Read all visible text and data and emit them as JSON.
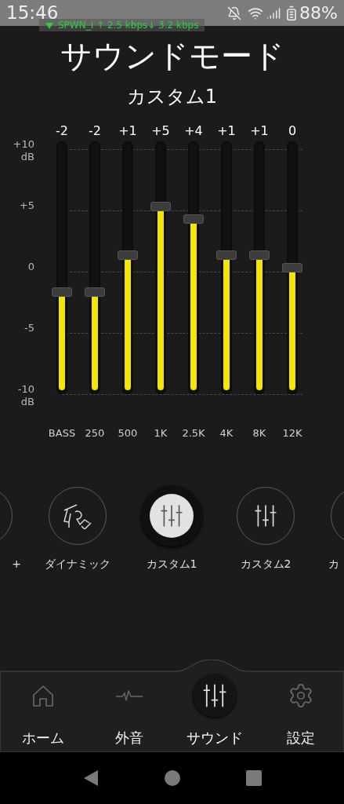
{
  "status_bar": {
    "time": "15:46",
    "battery": "88%",
    "network_overlay": "SPWN_I ↑  2.5 kbps↓  3.2 kbps"
  },
  "title": "サウンドモード",
  "preset_name": "カスタム1",
  "scale_labels": [
    {
      "value": "+10",
      "unit": "dB"
    },
    {
      "value": "+5"
    },
    {
      "value": "0"
    },
    {
      "value": "-5"
    },
    {
      "value": "-10",
      "unit": "dB"
    }
  ],
  "bands": [
    {
      "gain": "-2",
      "freq": "BASS",
      "level": 0.4
    },
    {
      "gain": "-2",
      "freq": "250",
      "level": 0.4
    },
    {
      "gain": "+1",
      "freq": "500",
      "level": 0.55
    },
    {
      "gain": "+5",
      "freq": "1K",
      "level": 0.75
    },
    {
      "gain": "+4",
      "freq": "2.5K",
      "level": 0.7
    },
    {
      "gain": "+1",
      "freq": "4K",
      "level": 0.55
    },
    {
      "gain": "+1",
      "freq": "8K",
      "level": 0.55
    },
    {
      "gain": "0",
      "freq": "12K",
      "level": 0.5
    }
  ],
  "presets": [
    {
      "label": "+",
      "kind": "blank",
      "selected": false
    },
    {
      "label": "ダイナミック",
      "kind": "dynamic",
      "selected": false
    },
    {
      "label": "カスタム1",
      "kind": "custom",
      "selected": true
    },
    {
      "label": "カスタム2",
      "kind": "custom",
      "selected": false
    },
    {
      "label": "カ",
      "selected": false
    }
  ],
  "bottom_nav": [
    {
      "label": "ホーム",
      "kind": "home",
      "selected": false
    },
    {
      "label": "外音",
      "kind": "ambient",
      "selected": false
    },
    {
      "label": "サウンド",
      "kind": "sound",
      "selected": true
    },
    {
      "label": "設定",
      "kind": "settings",
      "selected": false
    }
  ]
}
